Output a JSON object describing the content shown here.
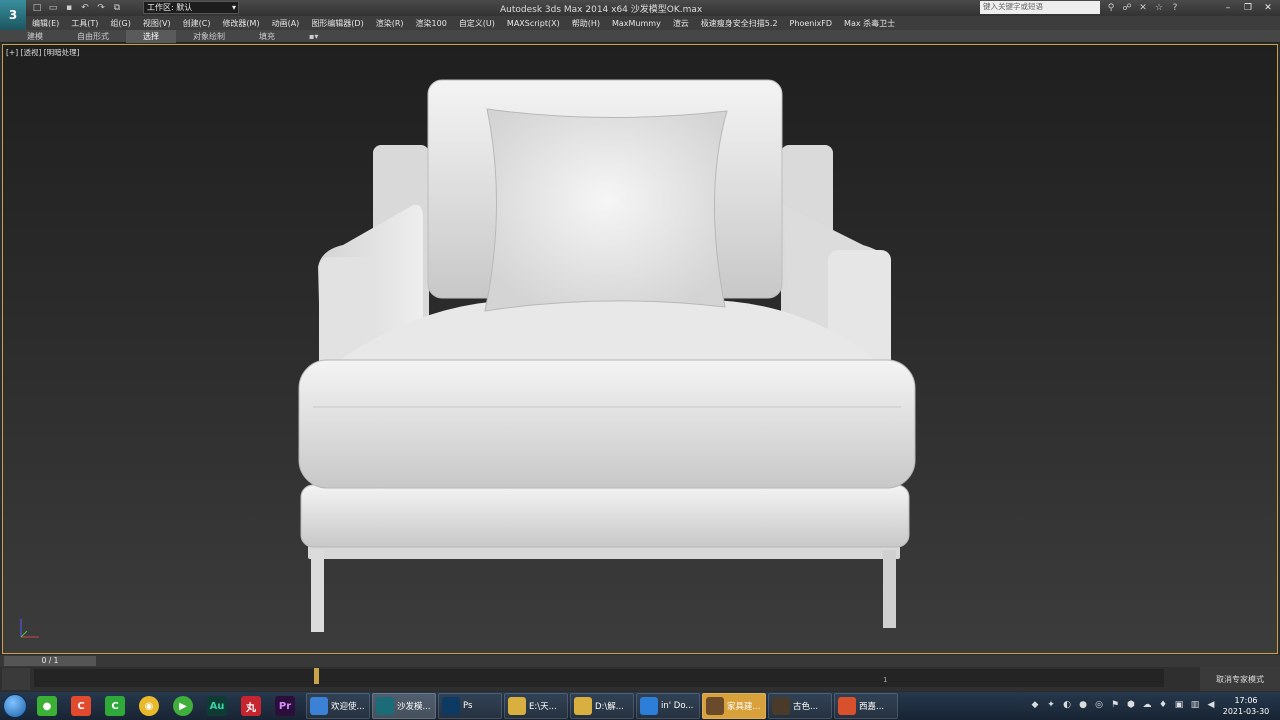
{
  "titlebar": {
    "workspace_label": "工作区: 默认",
    "title": "Autodesk 3ds Max  2014 x64      沙发模型OK.max",
    "search_placeholder": "键入关键字或短语"
  },
  "menu": [
    "编辑(E)",
    "工具(T)",
    "组(G)",
    "视图(V)",
    "创建(C)",
    "修改器(M)",
    "动画(A)",
    "图形编辑器(D)",
    "渲染(R)",
    "渲染100",
    "自定义(U)",
    "MAXScript(X)",
    "帮助(H)",
    "MaxMummy",
    "渲云",
    "极速瘦身安全扫描5.2",
    "PhoenixFD",
    "Max 杀毒卫士"
  ],
  "ribbon_tabs": [
    "建模",
    "自由形式",
    "选择",
    "对象绘制",
    "填充"
  ],
  "ribbon_active": "选择",
  "viewport": {
    "label": "[+] [透视] [明暗处理]"
  },
  "timeline": {
    "slider": "0 / 1",
    "tick": "1"
  },
  "expert_mode_button": "取消专家模式",
  "taskbar": {
    "tasks": [
      {
        "label": "欢迎使...",
        "color": "#3b82d6"
      },
      {
        "label": "沙发模...",
        "color": "#1c6b78"
      },
      {
        "label": "Ps",
        "color": "#0c3a63"
      },
      {
        "label": "E:\\天...",
        "color": "#d9b040"
      },
      {
        "label": "D:\\解...",
        "color": "#d9b040"
      },
      {
        "label": "in' Do...",
        "color": "#2c7ed6"
      },
      {
        "label": "家具建...",
        "color": "#6b4a2c"
      },
      {
        "label": "古色...",
        "color": "#4a3a2a"
      },
      {
        "label": "西嘉...",
        "color": "#d9502c"
      }
    ],
    "clock_time": "17:06",
    "clock_date": "2021-03-30"
  },
  "colors": {
    "accent": "#c9a34a",
    "taskbar": "#1e2d3e"
  }
}
